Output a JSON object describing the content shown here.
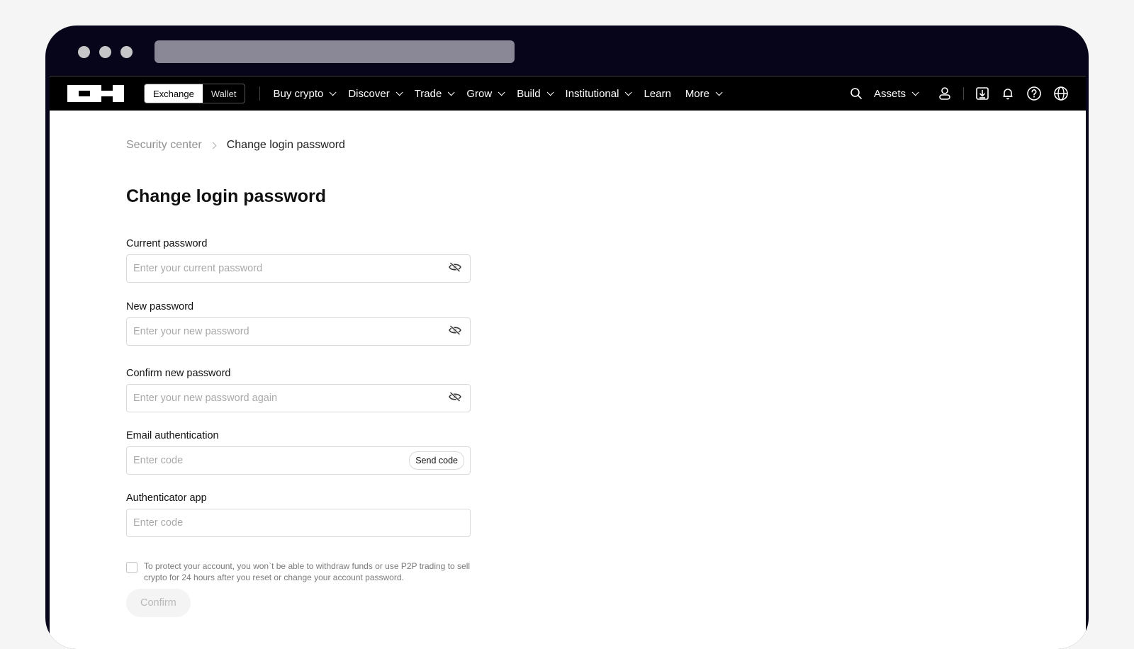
{
  "nav": {
    "toggle": [
      "Exchange",
      "Wallet"
    ],
    "items": [
      {
        "label": "Buy crypto",
        "dropdown": true
      },
      {
        "label": "Discover",
        "dropdown": true
      },
      {
        "label": "Trade",
        "dropdown": true
      },
      {
        "label": "Grow",
        "dropdown": true
      },
      {
        "label": "Build",
        "dropdown": true
      },
      {
        "label": "Institutional",
        "dropdown": true
      },
      {
        "label": "Learn",
        "dropdown": false
      },
      {
        "label": "More",
        "dropdown": true
      }
    ],
    "assets_label": "Assets"
  },
  "breadcrumb": {
    "parent": "Security center",
    "current": "Change login password"
  },
  "page_title": "Change login password",
  "form": {
    "current_password": {
      "label": "Current password",
      "placeholder": "Enter your current password",
      "value": ""
    },
    "new_password": {
      "label": "New password",
      "placeholder": "Enter your new password",
      "value": ""
    },
    "confirm_password": {
      "label": "Confirm new password",
      "placeholder": "Enter your new password again",
      "value": ""
    },
    "email_auth": {
      "label": "Email authentication",
      "placeholder": "Enter code",
      "value": "",
      "button": "Send code"
    },
    "authenticator": {
      "label": "Authenticator app",
      "placeholder": "Enter code",
      "value": ""
    },
    "agreement": "To protect your account, you won`t be able to withdraw funds or use P2P trading to sell crypto for 24 hours after you reset or change your account password.",
    "agreement_checked": false,
    "confirm_label": "Confirm"
  },
  "colors": {
    "frame": "#07051a",
    "nav_bg": "#000000",
    "disabled_text": "#b9b9b9"
  }
}
